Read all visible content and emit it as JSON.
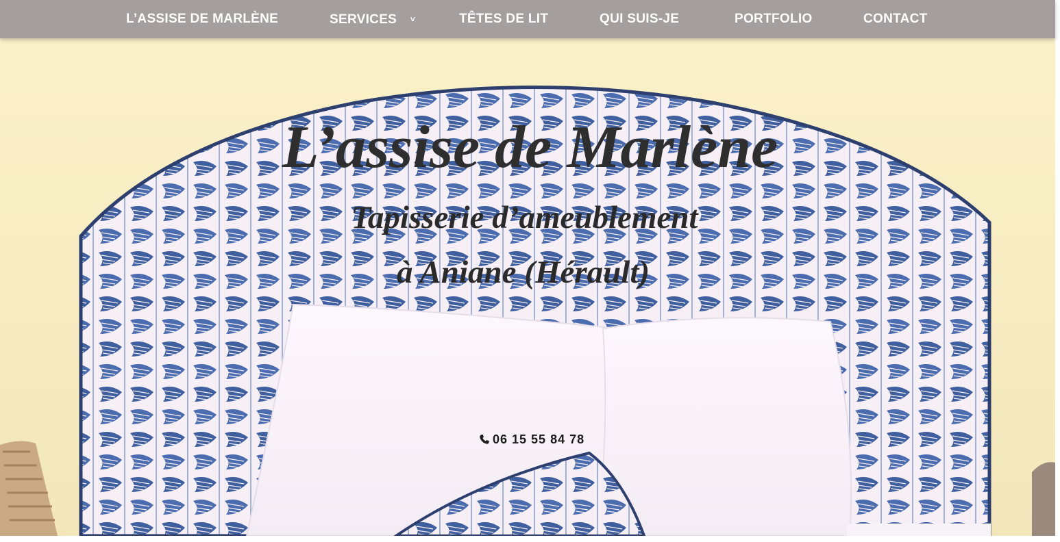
{
  "nav": {
    "items": [
      {
        "label": "L’ASSISE DE MARLÈNE"
      },
      {
        "label": "SERVICES",
        "chevron": "˅"
      },
      {
        "label": "TÊTES DE LIT"
      },
      {
        "label": "QUI SUIS-JE"
      },
      {
        "label": "PORTFOLIO"
      },
      {
        "label": "CONTACT"
      }
    ],
    "background": "#a59e9e"
  },
  "hero": {
    "title": "L’assise de Marlène",
    "subtitle_line1": "Tapisserie d’ameublement",
    "subtitle_line2": "à Aniane  (Hérault)",
    "phone": "06 15 55 84 78",
    "phone_icon": "phone-icon",
    "colors": {
      "wall": "#f7ecc1",
      "fabric_blue": "#4566a8",
      "fabric_white": "#f7f0f6",
      "pillow": "#fbf5fb"
    }
  }
}
